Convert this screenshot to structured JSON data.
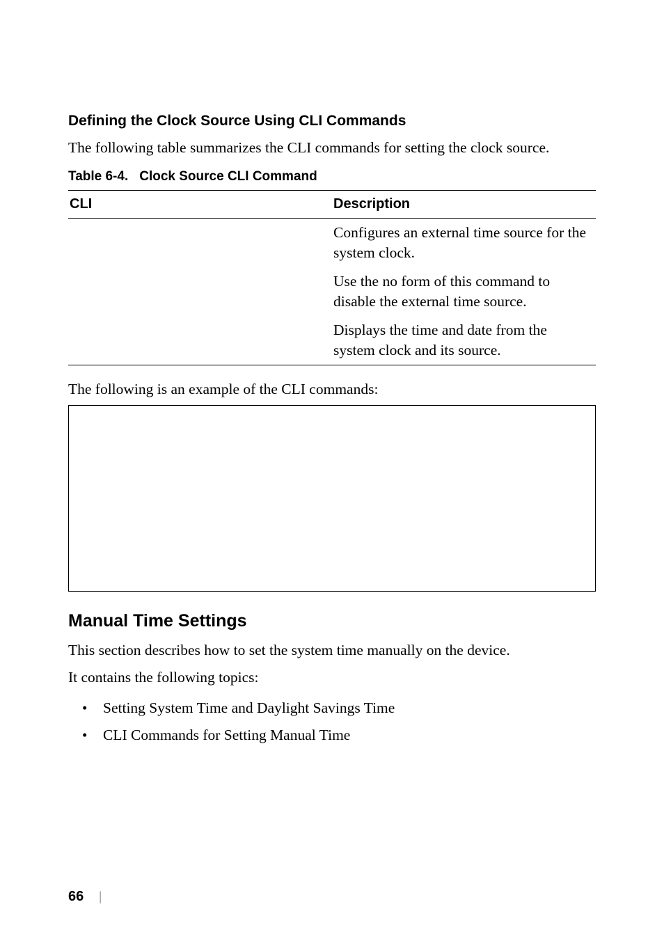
{
  "section1": {
    "heading": "Defining the Clock Source Using CLI Commands",
    "intro": "The following table summarizes the CLI commands for setting the clock source."
  },
  "table": {
    "caption_label": "Table 6-4.",
    "caption_title": "Clock Source CLI Command",
    "headers": {
      "col1": "CLI",
      "col2": "Description"
    },
    "rows": [
      {
        "cli": "",
        "desc": "Configures an external time source for the system clock."
      },
      {
        "cli": "",
        "desc": "Use the no form of this command to disable the external time source."
      },
      {
        "cli": "",
        "desc": "Displays the time and date from the system clock and its source."
      }
    ]
  },
  "example_intro": "The following is an example of the CLI commands:",
  "section2": {
    "heading": "Manual Time Settings",
    "para1": "This section describes how to set the system time manually on the device.",
    "para2": "It contains the following topics:",
    "bullets": [
      "Setting System Time and Daylight Savings Time",
      "CLI Commands for Setting Manual Time"
    ]
  },
  "footer": {
    "page": "66",
    "sep": "|"
  }
}
